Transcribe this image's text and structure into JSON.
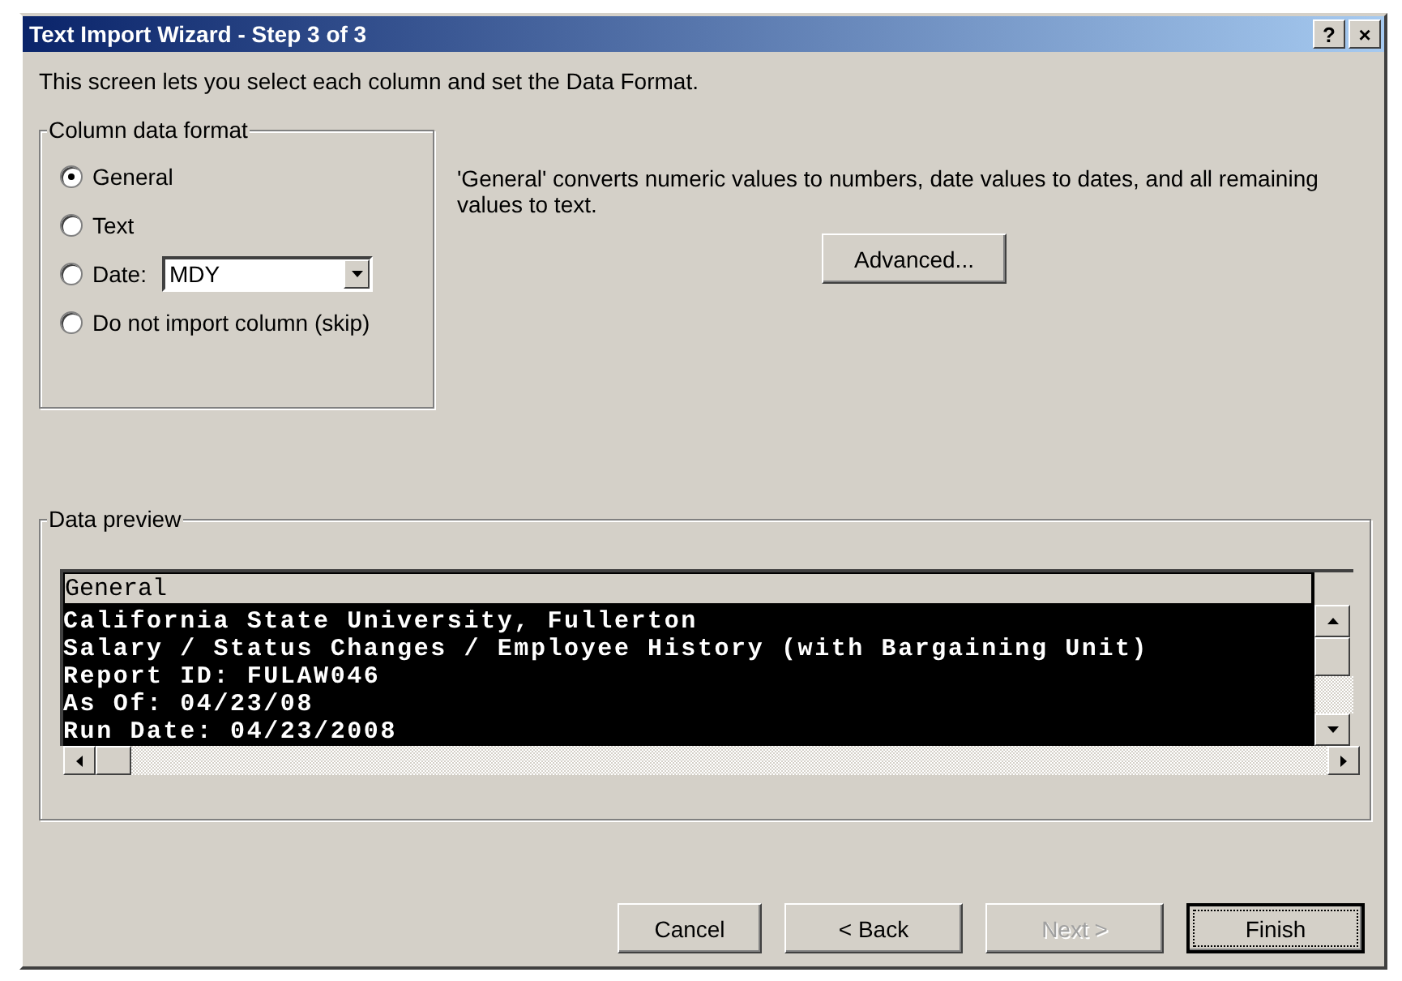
{
  "window": {
    "title": "Text Import Wizard - Step 3 of 3",
    "title_buttons": [
      "?",
      "×"
    ]
  },
  "intro": "This screen lets you select each column and set the Data Format.",
  "column_data_format": {
    "label": "Column data format",
    "options": [
      {
        "kind": "radio",
        "label": "General",
        "selected": true
      },
      {
        "kind": "radio",
        "label": "Text",
        "selected": false
      },
      {
        "kind": "date",
        "label": "Date:",
        "selected": false,
        "value": "MDY"
      },
      {
        "kind": "radio",
        "label": "Do not import column (skip)",
        "selected": false
      }
    ]
  },
  "description": "'General' converts numeric values to numbers, date values to dates, and all remaining values to text.",
  "advanced_button": "Advanced...",
  "data_preview": {
    "label": "Data preview",
    "columns": [
      {
        "header": "General",
        "selected": true
      }
    ],
    "rows": [
      "California State University, Fullerton",
      "Salary / Status Changes / Employee History (with Bargaining Unit)",
      "Report ID: FULAW046",
      "As Of: 04/23/08",
      "Run Date: 04/23/2008"
    ]
  },
  "buttons": [
    {
      "label": "Cancel",
      "disabled": false,
      "default": false
    },
    {
      "label": "< Back",
      "disabled": false,
      "default": false
    },
    {
      "label": "Next >",
      "disabled": true,
      "default": false
    },
    {
      "label": "Finish",
      "disabled": false,
      "default": true
    }
  ]
}
